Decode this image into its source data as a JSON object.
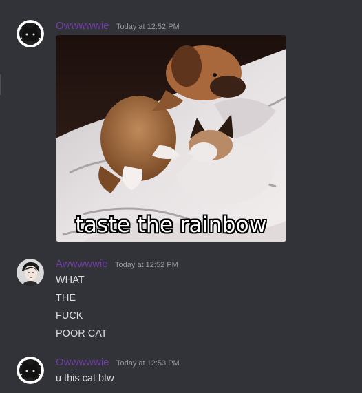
{
  "colors": {
    "background": "#313338",
    "username": "#6f3fa0",
    "timestamp": "#949ba4",
    "text": "#dbdee1"
  },
  "messages": [
    {
      "avatar_icon": "black-cat-avatar-icon",
      "username": "Owwwwwie",
      "timestamp": "Today at 12:52 PM",
      "attachment": {
        "type": "gif",
        "caption": "taste the rainbow"
      }
    },
    {
      "avatar_icon": "anime-character-avatar-icon",
      "username": "Awwwwwie",
      "timestamp": "Today at 12:52 PM",
      "lines": [
        "WHAT",
        "THE",
        "FUCK",
        "POOR CAT"
      ]
    },
    {
      "avatar_icon": "black-cat-avatar-icon",
      "username": "Owwwwwie",
      "timestamp": "Today at 12:53 PM",
      "lines": [
        "u this cat btw"
      ]
    }
  ]
}
